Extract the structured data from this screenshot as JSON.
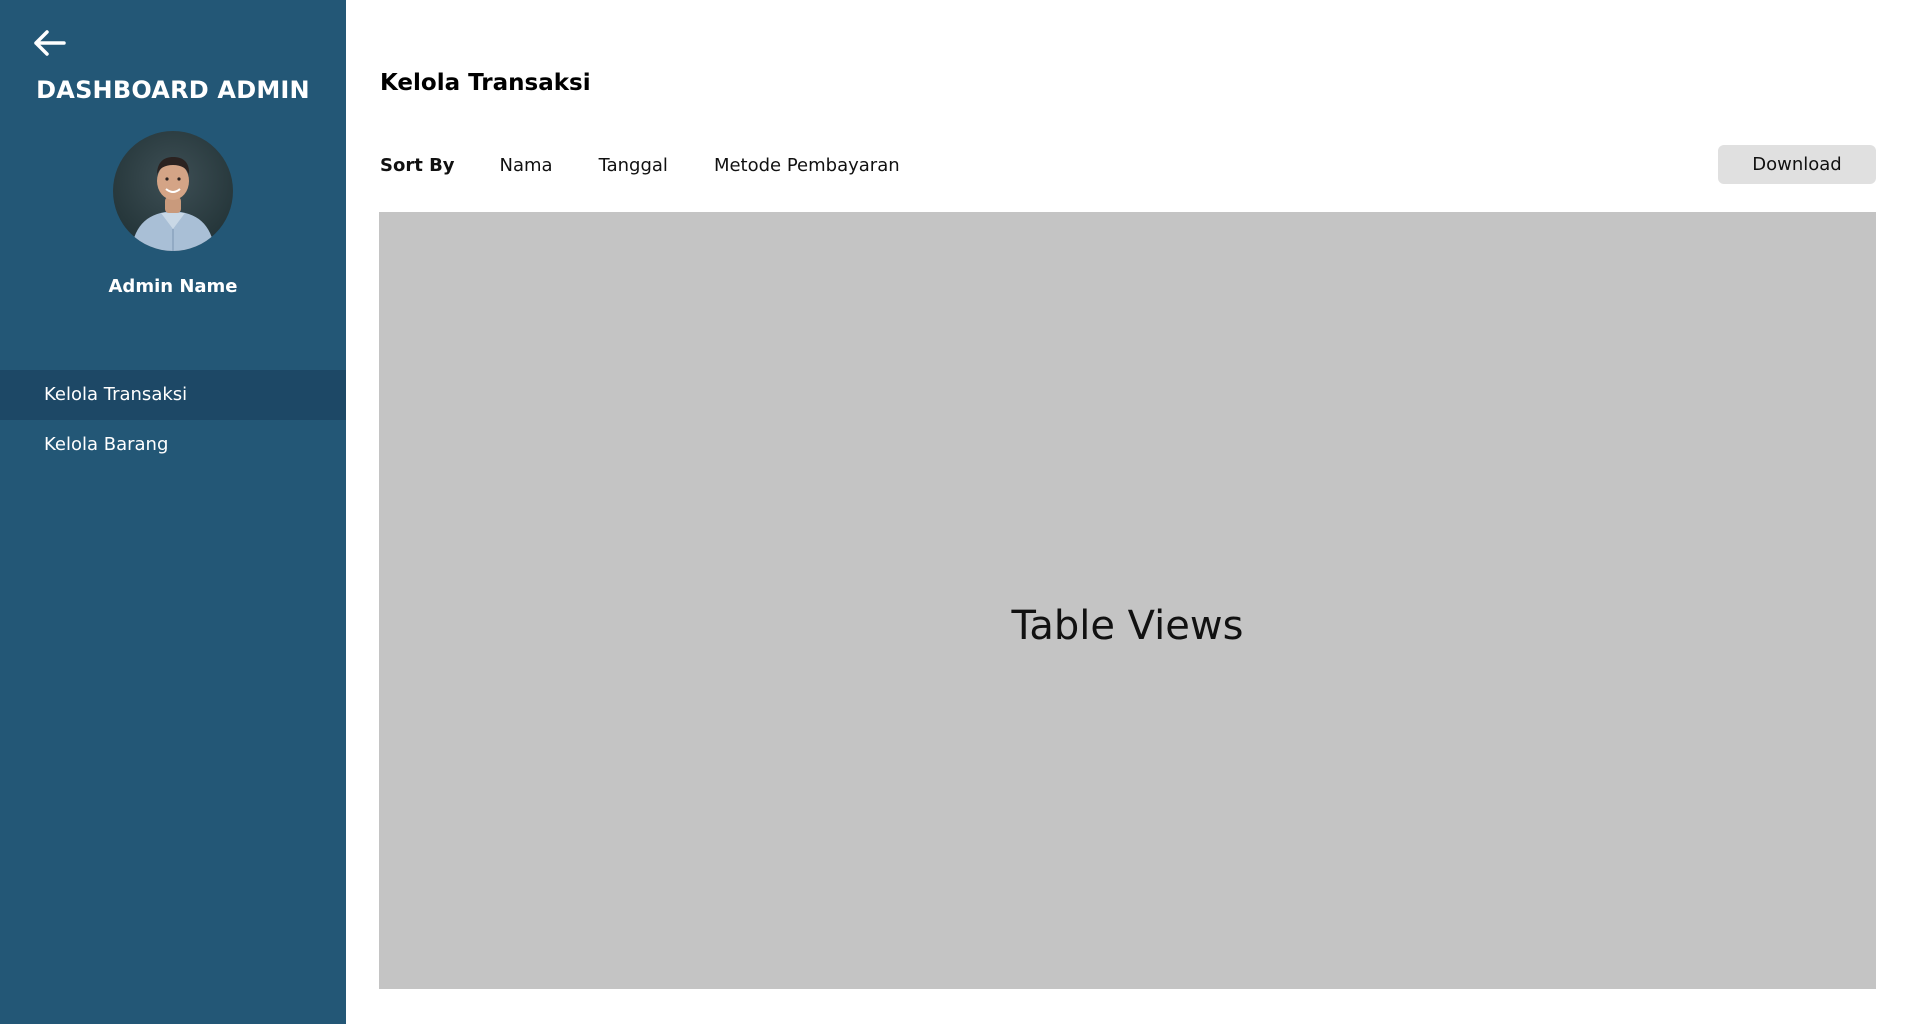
{
  "sidebar": {
    "back_icon": "arrow-left-icon",
    "title": "DASHBOARD ADMIN",
    "admin_name": "Admin Name",
    "items": [
      {
        "label": "Kelola Transaksi",
        "active": true
      },
      {
        "label": "Kelola Barang",
        "active": false
      }
    ]
  },
  "main": {
    "title": "Kelola Transaksi",
    "sort": {
      "label": "Sort By",
      "options": [
        "Nama",
        "Tanggal",
        "Metode Pembayaran"
      ]
    },
    "download_label": "Download",
    "table_placeholder": "Table Views"
  },
  "colors": {
    "sidebar_bg": "#235776",
    "sidebar_active_bg": "#1d4866",
    "table_bg": "#c4c4c4",
    "button_bg": "#e0e0e0"
  }
}
